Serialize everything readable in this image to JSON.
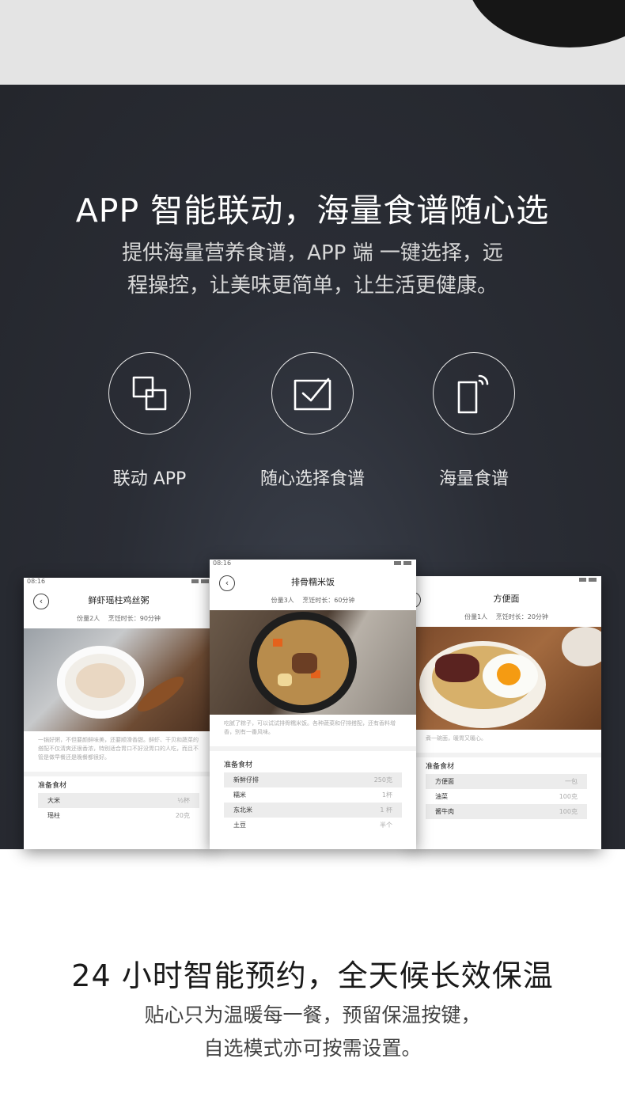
{
  "section1": {
    "heading": "APP 智能联动，海量食谱随心选",
    "subtitle_line1": "提供海量营养食谱，APP 端 一键选择，远",
    "subtitle_line2": "程操控，让美味更简单，让生活更健康。",
    "features": [
      {
        "icon": "linked-squares-icon",
        "label": "联动 APP"
      },
      {
        "icon": "checkbox-icon",
        "label": "随心选择食谱"
      },
      {
        "icon": "phone-signal-icon",
        "label": "海量食谱"
      }
    ]
  },
  "phones": {
    "left": {
      "time": "08:16",
      "title": "鲜虾瑶柱鸡丝粥",
      "meta": "份量2人　 烹饪时长：90分钟",
      "desc": "一锅好粥，不但要颜鲜味美，还要顺滑香甜。鲜虾、干贝和蔬菜的搭配不仅清爽还很香浓，特别适合胃口不好没胃口的人吃，而且不管是做早餐还是晚餐都很好。",
      "section": "准备食材",
      "ingredients": [
        {
          "name": "大米",
          "amount": "½杯"
        },
        {
          "name": "瑶柱",
          "amount": "20克"
        }
      ]
    },
    "center": {
      "time": "08:16",
      "title": "排骨糯米饭",
      "meta": "份量3人　 烹饪时长：60分钟",
      "desc": "吃腻了粽子，可以试试排骨糯米饭。各种蔬菜和仔排搭配，还有香料增香，别有一番风味。",
      "section": "准备食材",
      "ingredients": [
        {
          "name": "新鲜仔排",
          "amount": "250克"
        },
        {
          "name": "糯米",
          "amount": "1杯"
        },
        {
          "name": "东北米",
          "amount": "1 杯"
        },
        {
          "name": "土豆",
          "amount": "半个"
        }
      ]
    },
    "right": {
      "title": "方便面",
      "meta": "份量1人　 烹饪时长：20分钟",
      "desc": "煮一碗面，暖胃又暖心。",
      "section": "准备食材",
      "ingredients": [
        {
          "name": "方便面",
          "amount": "一包"
        },
        {
          "name": "油菜",
          "amount": "100克"
        },
        {
          "name": "酱牛肉",
          "amount": "100克"
        }
      ]
    }
  },
  "section2": {
    "heading": "24 小时智能预约，全天候长效保温",
    "subtitle_line1": "贴心只为温暖每一餐，预留保温按键，",
    "subtitle_line2": "自选模式亦可按需设置。"
  },
  "colors": {
    "dark_bg": "#26282e",
    "light_strip": "#e4e4e4"
  }
}
